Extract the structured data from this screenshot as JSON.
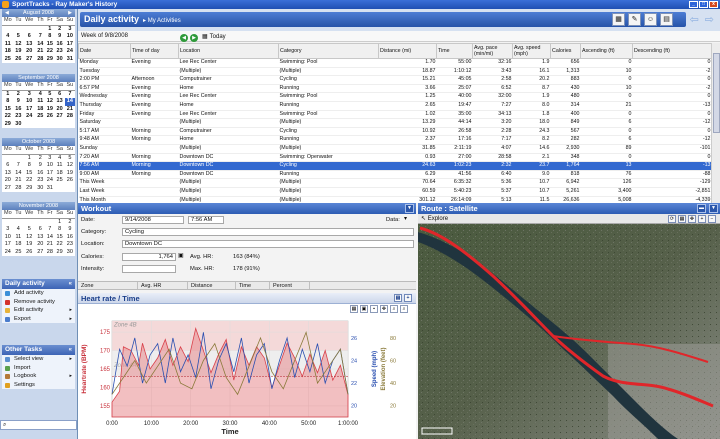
{
  "app": {
    "title": "SportTracks - Ray Maker's History"
  },
  "window_buttons": {
    "min": "_",
    "max": "□",
    "close": "x"
  },
  "calendars": [
    {
      "month": "August 2008",
      "weeks": [
        [
          "",
          "",
          "",
          "",
          "1",
          "2",
          "3"
        ],
        [
          "4",
          "5",
          "6",
          "7",
          "8",
          "9",
          "10"
        ],
        [
          "11",
          "12",
          "13",
          "14",
          "15",
          "16",
          "17"
        ],
        [
          "18",
          "19",
          "20",
          "21",
          "22",
          "23",
          "24"
        ],
        [
          "25",
          "26",
          "27",
          "28",
          "29",
          "30",
          "31"
        ]
      ]
    },
    {
      "month": "September 2008",
      "weeks": [
        [
          "1",
          "2",
          "3",
          "4",
          "5",
          "6",
          "7"
        ],
        [
          "8",
          "9",
          "10",
          "11",
          "12",
          "13",
          "14"
        ],
        [
          "15",
          "16",
          "17",
          "18",
          "19",
          "20",
          "21"
        ],
        [
          "22",
          "23",
          "24",
          "25",
          "26",
          "27",
          "28"
        ],
        [
          "29",
          "30",
          "",
          "",
          "",
          "",
          ""
        ]
      ]
    },
    {
      "month": "October 2008",
      "weeks": [
        [
          "",
          "",
          "1",
          "2",
          "3",
          "4",
          "5"
        ],
        [
          "6",
          "7",
          "8",
          "9",
          "10",
          "11",
          "12"
        ],
        [
          "13",
          "14",
          "15",
          "16",
          "17",
          "18",
          "19"
        ],
        [
          "20",
          "21",
          "22",
          "23",
          "24",
          "25",
          "26"
        ],
        [
          "27",
          "28",
          "29",
          "30",
          "31",
          "",
          ""
        ]
      ]
    },
    {
      "month": "November 2008",
      "weeks": [
        [
          "",
          "",
          "",
          "",
          "",
          "1",
          "2"
        ],
        [
          "3",
          "4",
          "5",
          "6",
          "7",
          "8",
          "9"
        ],
        [
          "10",
          "11",
          "12",
          "13",
          "14",
          "15",
          "16"
        ],
        [
          "17",
          "18",
          "19",
          "20",
          "21",
          "22",
          "23"
        ],
        [
          "24",
          "25",
          "26",
          "27",
          "28",
          "29",
          "30"
        ]
      ]
    }
  ],
  "weekday_headers": [
    "Mo",
    "Tu",
    "We",
    "Th",
    "Fr",
    "Sa",
    "Su"
  ],
  "daily_activity_panel": {
    "title": "Daily activity",
    "items": [
      {
        "label": "Add activity",
        "icon": "add-icon",
        "color": "#3a8ed8"
      },
      {
        "label": "Remove activity",
        "icon": "remove-icon",
        "color": "#d4332b"
      },
      {
        "label": "Edit activity",
        "icon": "edit-icon",
        "color": "#e7b33a"
      },
      {
        "label": "Export",
        "icon": "export-icon",
        "color": "#4a7ccc"
      }
    ]
  },
  "other_tasks_panel": {
    "title": "Other Tasks",
    "items": [
      {
        "label": "Select view",
        "icon": "select-view-icon",
        "color": "#5a8fd0"
      },
      {
        "label": "Import",
        "icon": "import-icon",
        "color": "#5aa04c"
      },
      {
        "label": "Logbook",
        "icon": "logbook-icon",
        "color": "#b47a3a"
      },
      {
        "label": "Settings",
        "icon": "settings-icon",
        "color": "#e0a020"
      }
    ]
  },
  "header": {
    "title": "Daily activity",
    "subtitle": "▸ My Activities"
  },
  "week": {
    "label": "Week of 9/8/2008",
    "today": "Today"
  },
  "grid": {
    "columns": [
      "Date",
      "Time of day",
      "Location",
      "Category",
      "Distance (mi)",
      "Time",
      "Avg. pace (min/mi)",
      "Avg. speed (mph)",
      "Calories",
      "Ascending (ft)",
      "Descending (ft)"
    ],
    "rows": [
      [
        "Monday",
        "Evening",
        "Lee Rec Center",
        "Swimming: Pool",
        "1.70",
        "55:00",
        "32:16",
        "1.9",
        "656",
        "0",
        "0"
      ],
      [
        "Tuesday",
        "",
        "(Multiple)",
        "(Multiple)",
        "18.87",
        "1:10:12",
        "3:43",
        "16.1",
        "1,313",
        "10",
        "-2"
      ],
      [
        "   2:00 PM",
        "Afternoon",
        "Computrainer",
        "Cycling",
        "15.21",
        "45:05",
        "2:58",
        "20.2",
        "883",
        "0",
        "0"
      ],
      [
        "   6:57 PM",
        "Evening",
        "Home",
        "Running",
        "3.66",
        "25:07",
        "6:52",
        "8.7",
        "430",
        "10",
        "-2"
      ],
      [
        "Wednesday",
        "Evening",
        "Lee Rec Center",
        "Swimming: Pool",
        "1.25",
        "40:00",
        "32:00",
        "1.9",
        "480",
        "0",
        "0"
      ],
      [
        "Thursday",
        "Evening",
        "Home",
        "Running",
        "2.65",
        "19:47",
        "7:27",
        "8.0",
        "314",
        "21",
        "-13"
      ],
      [
        "Friday",
        "Evening",
        "Lee Rec Center",
        "Swimming: Pool",
        "1.02",
        "35:00",
        "34:13",
        "1.8",
        "400",
        "0",
        "0"
      ],
      [
        "Saturday",
        "",
        "(Multiple)",
        "(Multiple)",
        "13.29",
        "44:14",
        "3:20",
        "18.0",
        "849",
        "6",
        "-12"
      ],
      [
        "   5:17 AM",
        "Morning",
        "Computrainer",
        "Cycling",
        "10.92",
        "26:58",
        "2:28",
        "24.3",
        "567",
        "0",
        "0"
      ],
      [
        "   9:48 AM",
        "Morning",
        "Home",
        "Running",
        "2.37",
        "17:16",
        "7:17",
        "8.2",
        "282",
        "6",
        "-12"
      ],
      [
        "Sunday",
        "",
        "(Multiple)",
        "(Multiple)",
        "31.85",
        "2:11:19",
        "4:07",
        "14.6",
        "2,930",
        "89",
        "-101"
      ],
      [
        "   7:20 AM",
        "Morning",
        "Downtown DC",
        "Swimming: Openwater",
        "0.93",
        "27:00",
        "28:58",
        "2.1",
        "348",
        "0",
        "0"
      ],
      [
        "   7:56 AM",
        "Morning",
        "Downtown DC",
        "Cycling",
        "24.63",
        "1:02:23",
        "2:32",
        "23.7",
        "1,764",
        "13",
        "-13"
      ],
      [
        "   9:00 AM",
        "Morning",
        "Downtown DC",
        "Running",
        "6.29",
        "41:56",
        "6:40",
        "9.0",
        "818",
        "76",
        "-88"
      ],
      [
        "This Week",
        "",
        "(Multiple)",
        "(Multiple)",
        "70.64",
        "6:35:32",
        "5:36",
        "10.7",
        "6,942",
        "126",
        "-129"
      ],
      [
        "Last Week",
        "",
        "(Multiple)",
        "(Multiple)",
        "60.59",
        "5:40:23",
        "5:37",
        "10.7",
        "5,261",
        "3,400",
        "-2,851"
      ],
      [
        "This Month",
        "",
        "(Multiple)",
        "(Multiple)",
        "301.12",
        "26:14:09",
        "5:13",
        "11.5",
        "26,636",
        "5,008",
        "-4,339"
      ]
    ],
    "selected_row": 12
  },
  "workout": {
    "title": "Workout",
    "date_label": "Date:",
    "date": "9/14/2008",
    "time": "7:56 AM",
    "data_label": "Data:",
    "category_label": "Category:",
    "category": "Cycling",
    "location_label": "Location:",
    "location": "Downtown DC",
    "calories_label": "Calories:",
    "calories": "1,764",
    "intensity_label": "Intensity:",
    "avg_hr_label": "Avg. HR:",
    "avg_hr": "163 (84%)",
    "max_hr_label": "Max. HR:",
    "max_hr": "178 (91%)",
    "zone_columns": [
      "Zone",
      "Avg. HR",
      "Distance",
      "Time",
      "Percent"
    ]
  },
  "hr_chart": {
    "title": "Heart rate / Time",
    "zone_labels": [
      "Zone 4B",
      "Zone 4A"
    ]
  },
  "chart_data": {
    "type": "line",
    "xlabel": "Time",
    "xticks": [
      "0:00",
      "10:00",
      "20:00",
      "30:00",
      "40:00",
      "50:00",
      "1:00:00"
    ],
    "ylabel_left": "Heartrate (BPM)",
    "ylabel_right1": "Speed (mph)",
    "ylabel_right2": "Elevation (feet)",
    "yticks_left": [
      155,
      160,
      165,
      170,
      175
    ],
    "yticks_right1": [
      20,
      22,
      24,
      26
    ],
    "yticks_right2": [
      20,
      40,
      60,
      80
    ],
    "ylim_left": [
      152,
      178
    ],
    "ylim_right1": [
      19,
      27.5
    ],
    "ylim_right2": [
      10,
      95
    ],
    "xlim": [
      0,
      62
    ],
    "series": [
      {
        "name": "Heartrate (BPM)",
        "color": "#d9414b",
        "x": [
          0,
          2,
          3,
          5,
          7,
          8,
          10,
          12,
          14,
          16,
          18,
          20,
          22,
          24,
          26,
          28,
          30,
          32,
          34,
          36,
          38,
          40,
          42,
          44,
          46,
          48,
          50,
          52,
          54,
          56,
          58,
          60,
          62
        ],
        "values": [
          156,
          159,
          171,
          170,
          166,
          172,
          165,
          168,
          173,
          166,
          171,
          167,
          176,
          170,
          164,
          169,
          173,
          162,
          171,
          166,
          171,
          168,
          160,
          166,
          172,
          168,
          163,
          169,
          164,
          170,
          162,
          166,
          158
        ]
      },
      {
        "name": "Speed (mph)",
        "color": "#2a4fb0",
        "x": [
          0,
          2,
          4,
          6,
          8,
          10,
          12,
          14,
          16,
          18,
          20,
          22,
          24,
          26,
          28,
          30,
          32,
          34,
          36,
          38,
          40,
          42,
          44,
          46,
          48,
          50,
          52,
          54,
          56,
          58,
          60,
          62
        ],
        "values": [
          21,
          25,
          23.5,
          26,
          22,
          24.5,
          25.5,
          22,
          26,
          23,
          24.5,
          22.5,
          26.5,
          21.5,
          24,
          25.5,
          23,
          26,
          22,
          24.5,
          25.5,
          21.5,
          24,
          26,
          22.5,
          25,
          23,
          25.5,
          22,
          24,
          25,
          21
        ]
      },
      {
        "name": "Elevation (feet)",
        "color": "#8a7a3a",
        "x": [
          0,
          3,
          6,
          9,
          12,
          15,
          18,
          21,
          24,
          27,
          30,
          33,
          36,
          39,
          42,
          45,
          48,
          51,
          54,
          57,
          60,
          62
        ],
        "values": [
          30,
          45,
          60,
          40,
          55,
          70,
          40,
          35,
          60,
          75,
          45,
          30,
          55,
          80,
          50,
          35,
          60,
          85,
          40,
          55,
          70,
          30
        ]
      }
    ]
  },
  "route": {
    "title": "Route : Satellite",
    "explore": "Explore"
  }
}
